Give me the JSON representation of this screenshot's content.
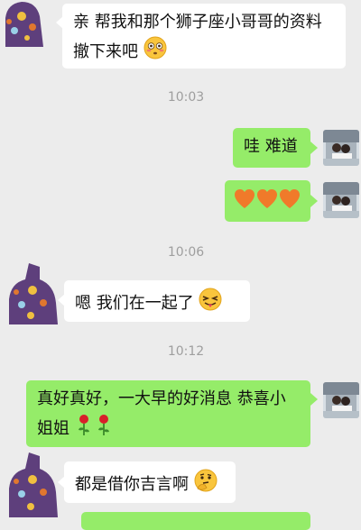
{
  "messages": [
    {
      "sender": "other",
      "text": "亲 帮我和那个狮子座小哥哥的资料撤下来吧",
      "emoji": "flushed-face-icon"
    },
    {
      "sender": "system",
      "time": "10:03"
    },
    {
      "sender": "me",
      "text": "哇  难道"
    },
    {
      "sender": "me",
      "emoji": "three-orange-hearts-icon"
    },
    {
      "sender": "system",
      "time": "10:06"
    },
    {
      "sender": "other",
      "text": "嗯  我们在一起了",
      "emoji": "tongue-out-face-icon"
    },
    {
      "sender": "system",
      "time": "10:12"
    },
    {
      "sender": "me",
      "text": "真好真好，一大早的好消息 恭喜小姐姐",
      "emoji": "two-roses-icon"
    },
    {
      "sender": "other",
      "text": "都是借你吉言啊",
      "emoji": "thinking-face-icon"
    }
  ],
  "colors": {
    "background": "#ececec",
    "incoming": "#ffffff",
    "outgoing": "#95ec69",
    "timestamp": "#9e9e9e"
  }
}
